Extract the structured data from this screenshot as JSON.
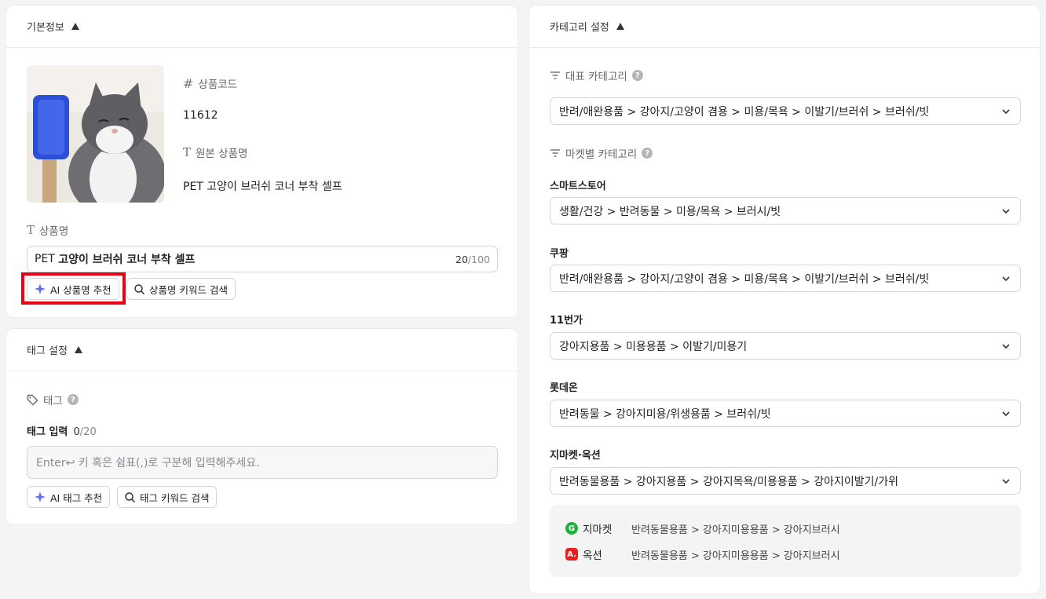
{
  "basic": {
    "title": "기본정보",
    "code_label": "상품코드",
    "code_value": "11612",
    "orig_label": "원본 상품명",
    "orig_value": "PET 고양이 브러쉬 코너 부착 셀프",
    "name_label": "상품명",
    "name_prefix": "PET ",
    "name_bold": "고양이 브러쉬 코너 부착 셀프",
    "count_current": "20",
    "count_max": "/100",
    "ai_button": "AI 상품명 추천",
    "keyword_button": "상품명 키워드 검색"
  },
  "tags": {
    "title": "태그 설정",
    "tag_label": "태그",
    "input_label": "태그 입력",
    "count_current": "0",
    "count_max": "/20",
    "placeholder": "Enter↩ 키 혹은 쉼표(,)로 구분해 입력해주세요.",
    "ai_button": "AI 태그 추천",
    "keyword_button": "태그 키워드 검색"
  },
  "category": {
    "title": "카테고리 설정",
    "main_label": "대표 카테고리",
    "main_value": "반려/애완용품 > 강아지/고양이 겸용 > 미용/목욕 > 이발기/브러쉬 > 브러쉬/빗",
    "market_label": "마켓별 카테고리",
    "markets": [
      {
        "name": "스마트스토어",
        "value": "생활/건강 > 반려동물 > 미용/목욕 > 브러시/빗"
      },
      {
        "name": "쿠팡",
        "value": "반려/애완용품 > 강아지/고양이 겸용 > 미용/목욕 > 이발기/브러쉬 > 브러쉬/빗"
      },
      {
        "name": "11번가",
        "value": "강아지용품 > 미용용품 > 이발기/미용기"
      },
      {
        "name": "롯데온",
        "value": "반려동물 > 강아지미용/위생용품 > 브러쉬/빗"
      },
      {
        "name": "지마켓·옥션",
        "value": "반려동물용품 > 강아지용품 > 강아지목욕/미용용품 > 강아지이발기/가위"
      }
    ],
    "sub": [
      {
        "badge": "G",
        "name": "지마켓",
        "path": "반려동물용품 > 강아지미용용품 > 강아지브러시",
        "color": "#1db33f"
      },
      {
        "badge": "A.",
        "name": "옥션",
        "path": "반려동물용품 > 강아지미용용품 > 강아지브러시",
        "color": "#e8201f"
      }
    ]
  },
  "colors": {
    "highlight": "#e60012",
    "ai_sparkle": "#5b6ef5"
  }
}
